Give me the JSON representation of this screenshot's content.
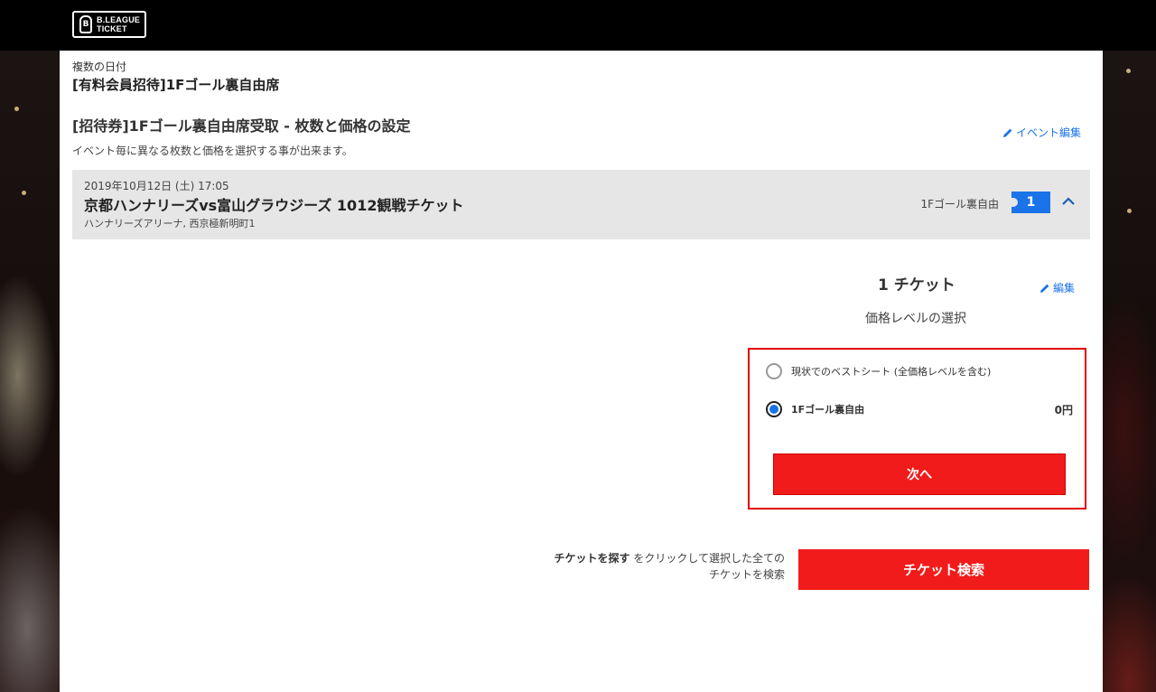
{
  "header": {
    "logo_line1": "B.LEAGUE",
    "logo_line2": "TICKET"
  },
  "page": {
    "breadcrumb": "複数の日付",
    "event_title": "[有料会員招待]1Fゴール裏自由席",
    "section_title": "[招待券]1Fゴール裏自由席受取 - 枚数と価格の設定",
    "section_desc": "イベント毎に異なる枚数と価格を選択する事が出来ます。",
    "edit_event_label": "イベント編集"
  },
  "event": {
    "datetime": "2019年10月12日 (土) 17:05",
    "name": "京都ハンナリーズvs富山グラウジーズ 1012観戦チケット",
    "venue": "ハンナリーズアリーナ, 西京極新明町1",
    "seat_type": "1Fゴール裏自由",
    "ticket_count": "1"
  },
  "selection": {
    "tickets_label": "1 チケット",
    "edit_label": "編集",
    "price_level_heading": "価格レベルの選択",
    "options": [
      {
        "label": "現状でのベストシート (全価格レベルを含む)",
        "price": "",
        "selected": false
      },
      {
        "label": "1Fゴール裏自由",
        "price": "0円",
        "selected": true
      }
    ],
    "next_button": "次へ"
  },
  "search": {
    "note_bold": "チケットを探す",
    "note_rest_line1": " をクリックして選択した全ての",
    "note_line2": "チケットを検索",
    "button": "チケット検索"
  },
  "colors": {
    "accent_red": "#f21b1b",
    "link_blue": "#1a73e8",
    "highlight_border": "#e00000"
  }
}
